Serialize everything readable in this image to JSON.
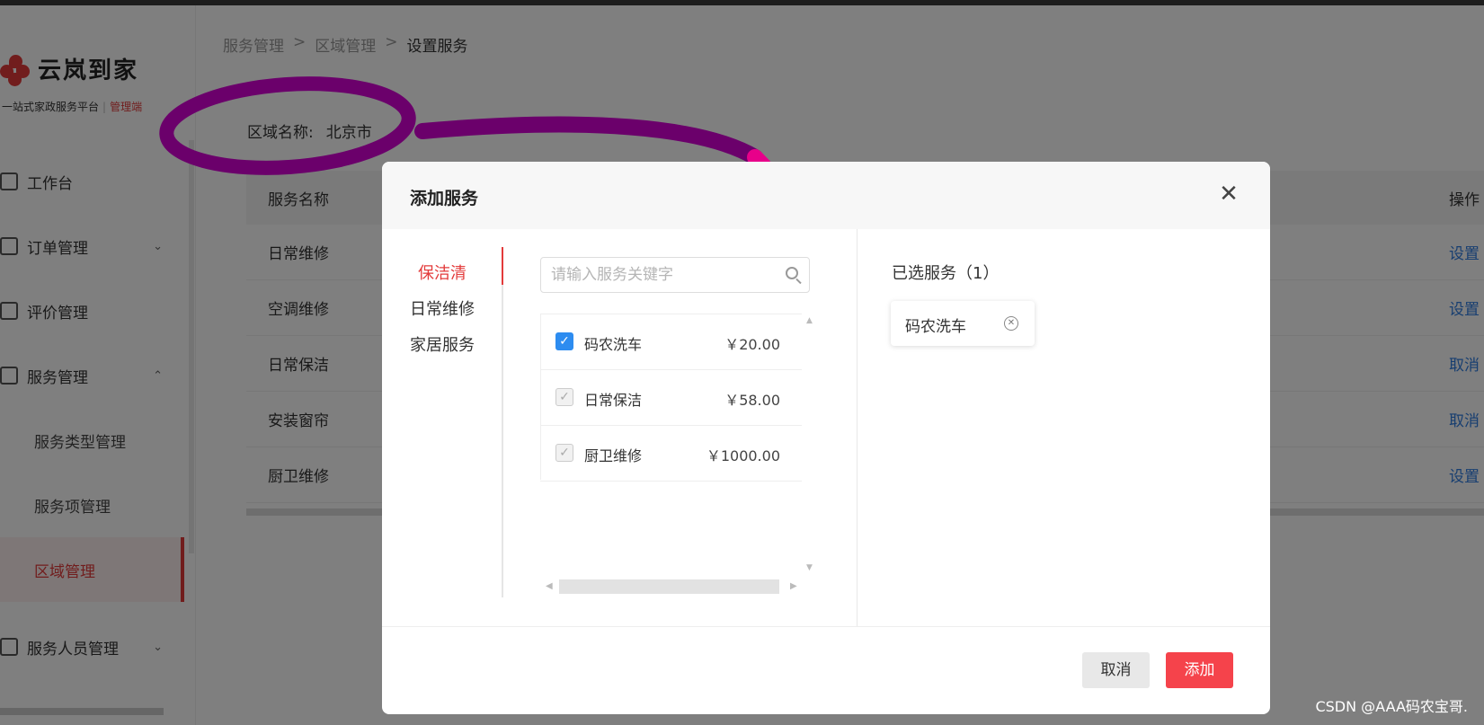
{
  "brand": {
    "name": "云岚到家",
    "subtitle": "一站式家政服务平台",
    "subtitle_tag": "管理端"
  },
  "sidebar": {
    "items": [
      {
        "label": "工作台",
        "icon": "monitor-icon"
      },
      {
        "label": "订单管理",
        "icon": "order-icon",
        "chevron": "⌄"
      },
      {
        "label": "评价管理",
        "icon": "review-icon"
      },
      {
        "label": "服务管理",
        "icon": "service-icon",
        "chevron": "⌃"
      }
    ],
    "submenu": [
      {
        "label": "服务类型管理"
      },
      {
        "label": "服务项管理"
      },
      {
        "label": "区域管理",
        "active": true
      }
    ],
    "items_after": [
      {
        "label": "服务人员管理",
        "icon": "staff-icon",
        "chevron": "⌄"
      }
    ]
  },
  "breadcrumb": [
    "服务管理",
    ">",
    "区域管理",
    ">",
    "设置服务"
  ],
  "region": {
    "label": "区域名称:",
    "value": "北京市"
  },
  "table": {
    "headers": [
      "服务名称",
      "操作"
    ],
    "rows": [
      {
        "name": "日常维修",
        "action": "设置"
      },
      {
        "name": "空调维修",
        "action": "设置"
      },
      {
        "name": "日常保洁",
        "action": "取消"
      },
      {
        "name": "安装窗帘",
        "action": "取消"
      },
      {
        "name": "厨卫维修",
        "action": "设置"
      }
    ]
  },
  "dialog": {
    "title": "添加服务",
    "close": "✕",
    "categories": [
      {
        "label": "保洁清",
        "active": true
      },
      {
        "label": "日常维修"
      },
      {
        "label": "家居服务"
      }
    ],
    "search_placeholder": "请输入服务关键字",
    "services": [
      {
        "name": "码农洗车",
        "price": "￥20.00",
        "checked": true
      },
      {
        "name": "日常保洁",
        "price": "￥58.00",
        "checked": false
      },
      {
        "name": "厨卫维修",
        "price": "￥1000.00",
        "checked": false
      }
    ],
    "selected_title": "已选服务（1）",
    "selected": [
      {
        "label": "码农洗车"
      }
    ],
    "cancel_label": "取消",
    "add_label": "添加"
  },
  "colors": {
    "accent": "#e33b3b",
    "link": "#2f7de1",
    "checkbox": "#2d8cf0",
    "annotation_purple": "#6b006b",
    "annotation_pink": "#e8008a"
  },
  "watermark": "CSDN @AAA码农宝哥."
}
